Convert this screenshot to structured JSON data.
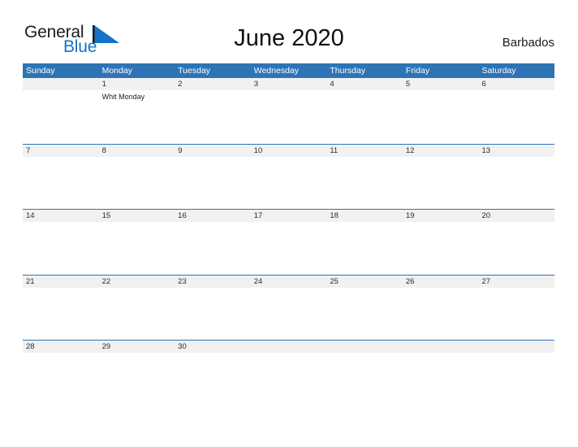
{
  "brand": {
    "name_part1": "General",
    "name_part2": "Blue",
    "flag_icon": "blue-triangle-flag-icon",
    "accent_color": "#1572c6"
  },
  "header": {
    "title": "June 2020",
    "country": "Barbados"
  },
  "theme": {
    "header_blue": "#2e74b5",
    "date_band_gray": "#f1f1f1",
    "text_dark": "#1b1b1b"
  },
  "calendar": {
    "weekdays": [
      "Sunday",
      "Monday",
      "Tuesday",
      "Wednesday",
      "Thursday",
      "Friday",
      "Saturday"
    ],
    "weeks": [
      [
        {
          "date": "",
          "events": []
        },
        {
          "date": "1",
          "events": [
            "Whit Monday"
          ]
        },
        {
          "date": "2",
          "events": []
        },
        {
          "date": "3",
          "events": []
        },
        {
          "date": "4",
          "events": []
        },
        {
          "date": "5",
          "events": []
        },
        {
          "date": "6",
          "events": []
        }
      ],
      [
        {
          "date": "7",
          "events": []
        },
        {
          "date": "8",
          "events": []
        },
        {
          "date": "9",
          "events": []
        },
        {
          "date": "10",
          "events": []
        },
        {
          "date": "11",
          "events": []
        },
        {
          "date": "12",
          "events": []
        },
        {
          "date": "13",
          "events": []
        }
      ],
      [
        {
          "date": "14",
          "events": []
        },
        {
          "date": "15",
          "events": []
        },
        {
          "date": "16",
          "events": []
        },
        {
          "date": "17",
          "events": []
        },
        {
          "date": "18",
          "events": []
        },
        {
          "date": "19",
          "events": []
        },
        {
          "date": "20",
          "events": []
        }
      ],
      [
        {
          "date": "21",
          "events": []
        },
        {
          "date": "22",
          "events": []
        },
        {
          "date": "23",
          "events": []
        },
        {
          "date": "24",
          "events": []
        },
        {
          "date": "25",
          "events": []
        },
        {
          "date": "26",
          "events": []
        },
        {
          "date": "27",
          "events": []
        }
      ],
      [
        {
          "date": "28",
          "events": []
        },
        {
          "date": "29",
          "events": []
        },
        {
          "date": "30",
          "events": []
        },
        {
          "date": "",
          "events": []
        },
        {
          "date": "",
          "events": []
        },
        {
          "date": "",
          "events": []
        },
        {
          "date": "",
          "events": []
        }
      ]
    ]
  }
}
